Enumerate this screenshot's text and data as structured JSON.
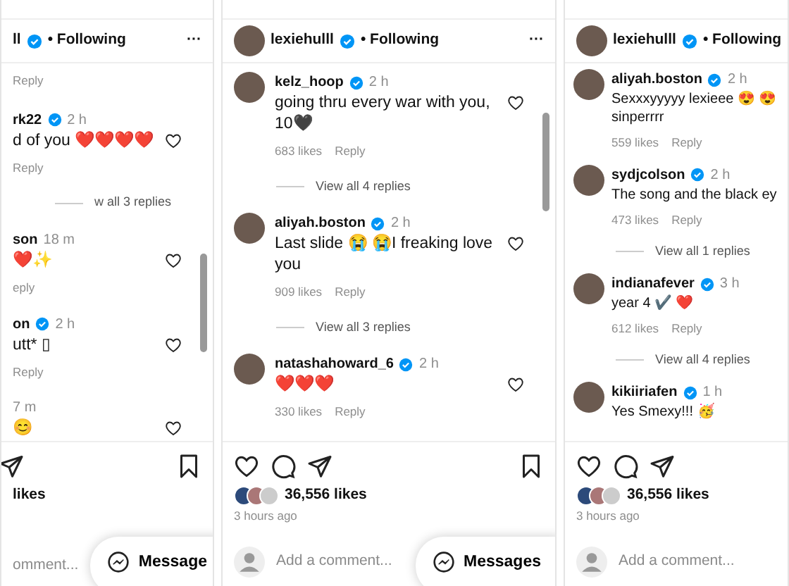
{
  "panels": [
    {
      "header": {
        "avatar": false,
        "username": "ll",
        "verified": true,
        "following": "• Following",
        "more": "···"
      },
      "items": [
        {
          "kind": "meta",
          "reply": "Reply"
        },
        {
          "kind": "comment",
          "avatar": false,
          "username": "rk22",
          "verified": true,
          "time": "2 h",
          "text": "d of you ❤️❤️❤️❤️",
          "reply": "Reply"
        },
        {
          "kind": "view_replies",
          "text": "w all 3 replies"
        },
        {
          "kind": "comment",
          "avatar": false,
          "username": "son",
          "verified": false,
          "time": "18 m",
          "text": "❤️✨",
          "reply": "eply"
        },
        {
          "kind": "comment",
          "avatar": false,
          "username": "on",
          "verified": true,
          "time": "2 h",
          "text": "utt* ▯",
          "reply": "Reply"
        },
        {
          "kind": "comment",
          "avatar": false,
          "verified": false,
          "time": "7 m",
          "text": "😊"
        }
      ],
      "actions": {
        "like": false,
        "comment": false,
        "share": true,
        "save": true
      },
      "likes": "likes",
      "placeholder": "omment...",
      "comment_avatar": false,
      "messages": "Message"
    },
    {
      "header": {
        "avatar": true,
        "username": "lexiehulll",
        "verified": true,
        "following": "• Following",
        "more": "···"
      },
      "items": [
        {
          "kind": "comment",
          "avatar": true,
          "username": "kelz_hoop",
          "verified": true,
          "time": "2 h",
          "text": "going thru every war with you, 10🖤",
          "likes": "683 likes",
          "reply": "Reply"
        },
        {
          "kind": "view_replies",
          "text": "View all 4 replies"
        },
        {
          "kind": "comment",
          "avatar": true,
          "username": "aliyah.boston",
          "verified": true,
          "time": "2 h",
          "text": "Last slide 😭 😭I freaking love you",
          "likes": "909 likes",
          "reply": "Reply"
        },
        {
          "kind": "view_replies",
          "text": "View all 3 replies"
        },
        {
          "kind": "comment",
          "avatar": true,
          "username": "natashahoward_6",
          "verified": true,
          "time": "2 h",
          "text": "❤️❤️❤️",
          "likes": "330 likes",
          "reply": "Reply"
        }
      ],
      "actions": {
        "like": true,
        "comment": true,
        "share": true,
        "save": true
      },
      "likes": "36,556 likes",
      "time_ago": "3 hours ago",
      "placeholder": "Add a comment...",
      "comment_avatar": true,
      "messages": "Messages"
    },
    {
      "header": {
        "avatar": true,
        "username": "lexiehulll",
        "verified": true,
        "following": "• Following"
      },
      "items": [
        {
          "kind": "comment",
          "avatar": true,
          "username": "aliyah.boston",
          "verified": true,
          "time": "2 h",
          "text": "Sexxxyyyyy lexieee 😍 😍 sinperrrr",
          "likes": "559 likes",
          "reply": "Reply"
        },
        {
          "kind": "comment",
          "avatar": true,
          "username": "sydjcolson",
          "verified": true,
          "time": "2 h",
          "text": "The song and the black ey",
          "likes": "473 likes",
          "reply": "Reply"
        },
        {
          "kind": "view_replies",
          "text": "View all 1 replies"
        },
        {
          "kind": "comment",
          "avatar": true,
          "username": "indianafever",
          "verified": true,
          "time": "3 h",
          "text": "year 4 ✔️ ❤️",
          "likes": "612 likes",
          "reply": "Reply"
        },
        {
          "kind": "view_replies",
          "text": "View all 4 replies"
        },
        {
          "kind": "comment",
          "avatar": true,
          "username": "kikiiriafen",
          "verified": true,
          "time": "1 h",
          "text": "Yes Smexy!!! 🥳"
        }
      ],
      "actions": {
        "like": true,
        "comment": true,
        "share": true,
        "save": false
      },
      "likes": "36,556 likes",
      "time_ago": "3 hours ago",
      "placeholder": "Add a comment...",
      "comment_avatar": true
    }
  ]
}
